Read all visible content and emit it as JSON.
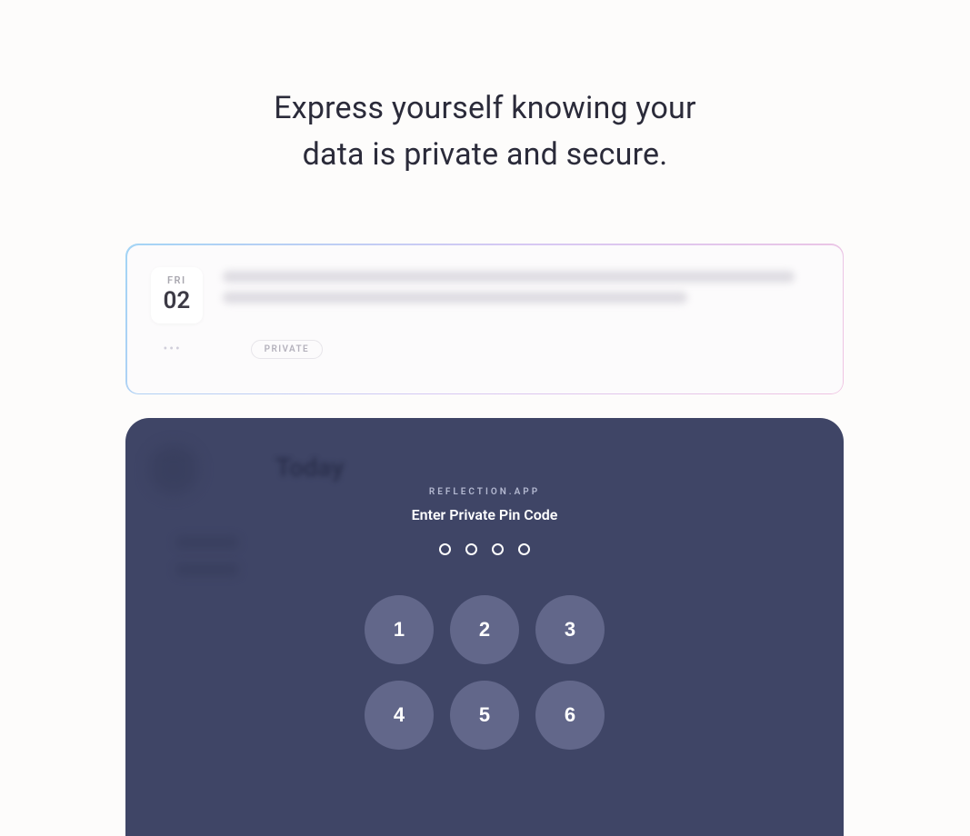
{
  "headline": {
    "line1": "Express yourself knowing your",
    "line2": "data is private and secure."
  },
  "entry": {
    "dayAbbrev": "FRI",
    "dayNumber": "02",
    "privateTag": "PRIVATE"
  },
  "pinScreen": {
    "backgroundTitle": "Today",
    "appLabel": "REFLECTION.APP",
    "prompt": "Enter Private Pin Code",
    "keys": [
      "1",
      "2",
      "3",
      "4",
      "5",
      "6"
    ]
  }
}
